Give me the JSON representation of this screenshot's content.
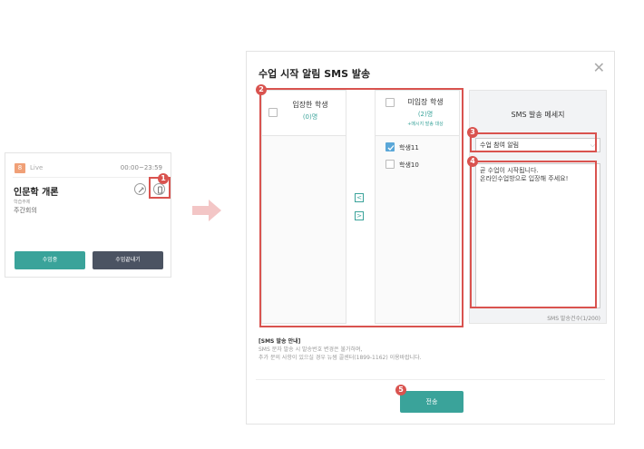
{
  "card": {
    "badge": "8",
    "live": "Live",
    "time": "00:00~23:59",
    "title": "인문학 개론",
    "sub1": "학습주제",
    "sub2": "주간회의",
    "enter_label": "수업중",
    "end_label": "수업끝내기"
  },
  "markers": [
    "1",
    "2",
    "3",
    "4",
    "5"
  ],
  "modal": {
    "title": "수업 시작 알림 SMS 발송",
    "close": "✕",
    "entered": {
      "title": "입장한 학생",
      "count": "(0)명"
    },
    "not_entered": {
      "title": "미입장 학생",
      "count": "(2)명",
      "note": "+메시지 발송 대상",
      "students": [
        {
          "name": "학생11",
          "checked": true
        },
        {
          "name": "학생10",
          "checked": false
        }
      ]
    },
    "move_left": "<",
    "move_right": ">",
    "sms": {
      "title": "SMS 발송 메세지",
      "select_value": "수업 참여 알림",
      "message_line1": "곧 수업이 시작됩니다.",
      "message_line2": "온라인수업방으로 입장해 주세요!",
      "counter": "SMS 발송건수(1/200)"
    },
    "guide": {
      "title": "[SMS 발송 안내]",
      "line1": "SMS 문자 발송 시 발송번호 변경은 불가하며,",
      "line2": "추가 문의 사항이 있으실 경우 뉴썸 콜센터(1899-1162) 이용바랍니다."
    },
    "send_label": "전송"
  },
  "colors": {
    "accent": "#3aa39a",
    "highlight": "#d9534f",
    "dark_button": "#4b5362",
    "badge": "#f0a077",
    "checkbox": "#5aa7d8"
  }
}
